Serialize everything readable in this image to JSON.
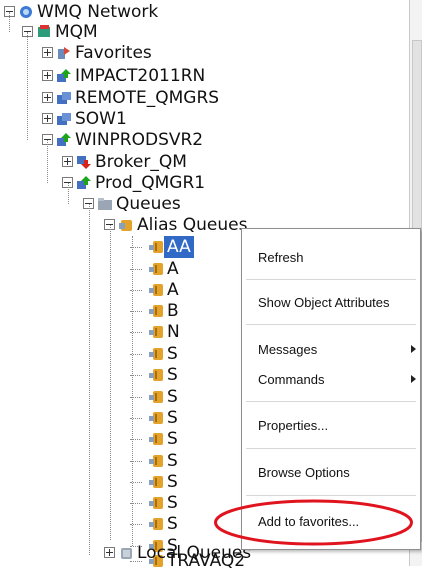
{
  "tree": {
    "items": [
      {
        "label": "WMQ Network",
        "icon": "network-icon",
        "toggle": "minus"
      },
      {
        "label": "MQM",
        "icon": "mqm-icon",
        "toggle": "minus"
      },
      {
        "label": "Favorites",
        "icon": "favorites-icon",
        "toggle": "plus"
      },
      {
        "label": "IMPACT2011RN",
        "icon": "qmgr-running-icon",
        "toggle": "plus"
      },
      {
        "label": "REMOTE_QMGRS",
        "icon": "qmgr-group-icon",
        "toggle": "plus"
      },
      {
        "label": "SOW1",
        "icon": "qmgr-group-icon",
        "toggle": "plus"
      },
      {
        "label": "WINPRODSVR2",
        "icon": "qmgr-running-icon",
        "toggle": "minus"
      },
      {
        "label": "Broker_QM",
        "icon": "qmgr-stopped-icon",
        "toggle": "plus"
      },
      {
        "label": "Prod_QMGR1",
        "icon": "qmgr-running-icon",
        "toggle": "minus"
      },
      {
        "label": "Queues",
        "icon": "queues-folder-icon",
        "toggle": "minus"
      },
      {
        "label": "Alias Queues",
        "icon": "alias-queues-icon",
        "toggle": "minus"
      },
      {
        "label": "AA",
        "icon": "queue-icon",
        "toggle": "none",
        "selected": true
      },
      {
        "label": "A",
        "icon": "queue-icon",
        "toggle": "none"
      },
      {
        "label": "A",
        "icon": "queue-icon",
        "toggle": "none"
      },
      {
        "label": "B",
        "icon": "queue-icon",
        "toggle": "none"
      },
      {
        "label": "N",
        "icon": "queue-icon",
        "toggle": "none"
      },
      {
        "label": "S",
        "icon": "queue-icon",
        "toggle": "none"
      },
      {
        "label": "S",
        "icon": "queue-icon",
        "toggle": "none"
      },
      {
        "label": "S",
        "icon": "queue-icon",
        "toggle": "none"
      },
      {
        "label": "S",
        "icon": "queue-icon",
        "toggle": "none"
      },
      {
        "label": "S",
        "icon": "queue-icon",
        "toggle": "none"
      },
      {
        "label": "S",
        "icon": "queue-icon",
        "toggle": "none"
      },
      {
        "label": "S",
        "icon": "queue-icon",
        "toggle": "none"
      },
      {
        "label": "S",
        "icon": "queue-icon",
        "toggle": "none"
      },
      {
        "label": "S",
        "icon": "queue-icon",
        "toggle": "none"
      },
      {
        "label": "S",
        "icon": "queue-icon",
        "toggle": "none"
      },
      {
        "label": "TRAVAQ2",
        "icon": "queue-icon",
        "toggle": "none"
      },
      {
        "label": "Local Queues",
        "icon": "local-queues-icon",
        "toggle": "plus"
      }
    ]
  },
  "context_menu": {
    "refresh": "Refresh",
    "show_attributes": "Show Object Attributes",
    "messages": "Messages",
    "commands": "Commands",
    "properties": "Properties...",
    "browse_options": "Browse Options",
    "add_to_favorites": "Add to favorites..."
  },
  "colors": {
    "selection": "#3169c6",
    "highlight_oval": "#e0141e",
    "queue_icon": "#e3a22a"
  }
}
